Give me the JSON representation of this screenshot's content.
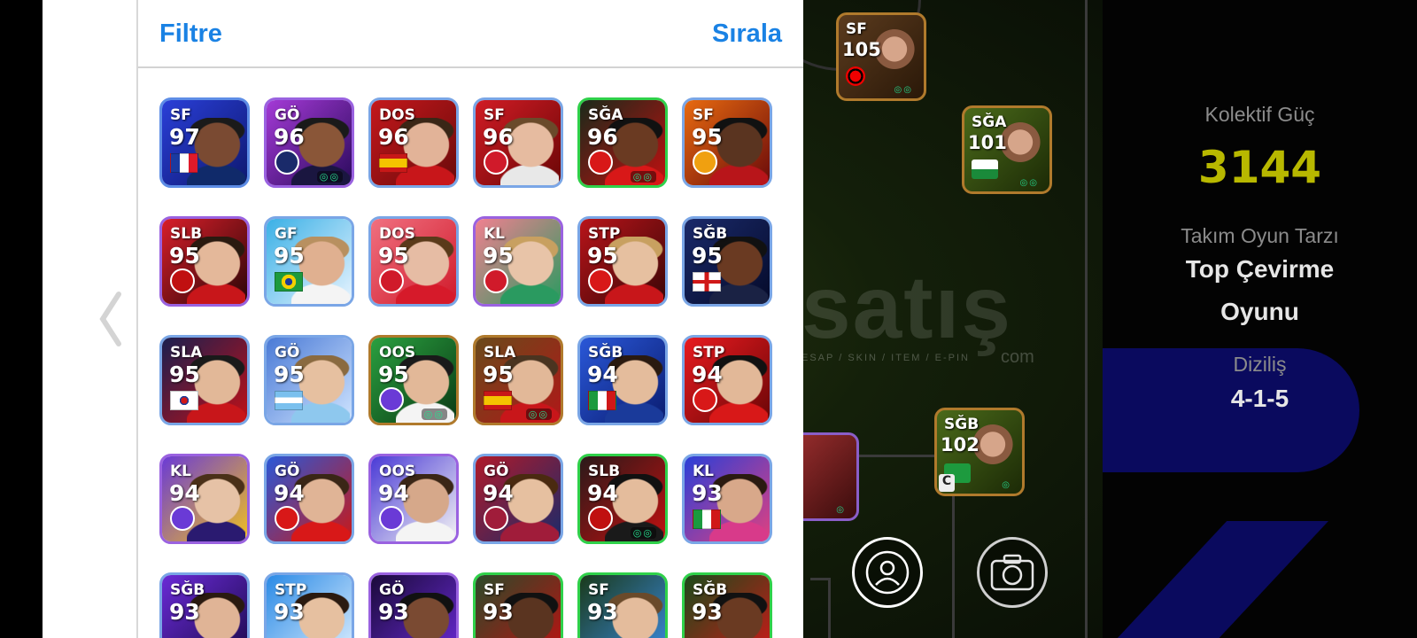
{
  "panel": {
    "filter_label": "Filtre",
    "sort_label": "Sırala"
  },
  "team_info": {
    "collective_power_label": "Kolektif Güç",
    "collective_power_value": "3144",
    "play_style_label": "Takım Oyun Tarzı",
    "play_style_line1": "Top Çevirme",
    "play_style_line2": "Oyunu",
    "formation_label": "Diziliş",
    "formation_value": "4-1-5"
  },
  "watermark": {
    "main": "satış",
    "sub": "ESAP / SKIN / ITEM / E-PIN",
    "com": "com"
  },
  "pitch_players": [
    {
      "pos": "SF",
      "rating": "105"
    },
    {
      "pos": "SĞA",
      "rating": "101"
    },
    {
      "pos": "SĞB",
      "rating": "102",
      "captain": "C"
    }
  ],
  "players": [
    {
      "pos": "SF",
      "rating": "97",
      "flag": "fr"
    },
    {
      "pos": "GÖ",
      "rating": "96",
      "crest": "psg"
    },
    {
      "pos": "DOS",
      "rating": "96",
      "flag": "es"
    },
    {
      "pos": "SF",
      "rating": "96",
      "crest": "pes"
    },
    {
      "pos": "SĞA",
      "rating": "96",
      "crest": "arsenal"
    },
    {
      "pos": "SF",
      "rating": "95",
      "crest": "galatasaray"
    },
    {
      "pos": "SLB",
      "rating": "95",
      "crest": "milan"
    },
    {
      "pos": "GF",
      "rating": "95",
      "flag": "br"
    },
    {
      "pos": "DOS",
      "rating": "95",
      "crest": "pes"
    },
    {
      "pos": "KL",
      "rating": "95",
      "crest": "pes"
    },
    {
      "pos": "STP",
      "rating": "95",
      "crest": "manutd"
    },
    {
      "pos": "SĞB",
      "rating": "95",
      "flag": "en"
    },
    {
      "pos": "SLA",
      "rating": "95",
      "flag": "kr"
    },
    {
      "pos": "GÖ",
      "rating": "95",
      "flag": "ar"
    },
    {
      "pos": "OOS",
      "rating": "95",
      "crest": "club"
    },
    {
      "pos": "SLA",
      "rating": "95",
      "flag": "es"
    },
    {
      "pos": "SĞB",
      "rating": "94",
      "flag": "it"
    },
    {
      "pos": "STP",
      "rating": "94",
      "crest": "manutd"
    },
    {
      "pos": "KL",
      "rating": "94",
      "crest": "club"
    },
    {
      "pos": "GÖ",
      "rating": "94",
      "crest": "benfica"
    },
    {
      "pos": "OOS",
      "rating": "94",
      "crest": "club"
    },
    {
      "pos": "GÖ",
      "rating": "94",
      "crest": "barcelona"
    },
    {
      "pos": "SLB",
      "rating": "94",
      "crest": "milan"
    },
    {
      "pos": "KL",
      "rating": "93",
      "flag": "it"
    },
    {
      "pos": "SĞB",
      "rating": "93"
    },
    {
      "pos": "STP",
      "rating": "93"
    },
    {
      "pos": "GÖ",
      "rating": "93"
    },
    {
      "pos": "SF",
      "rating": "93"
    },
    {
      "pos": "SF",
      "rating": "93"
    },
    {
      "pos": "SĞB",
      "rating": "93"
    }
  ],
  "colors": {
    "accent": "#1a82e4",
    "power": "#b8b800",
    "border_blue": "#7aa6e6",
    "border_green": "#2fd14a",
    "border_purple": "#9a62e0",
    "border_gold": "#b07a2c"
  }
}
